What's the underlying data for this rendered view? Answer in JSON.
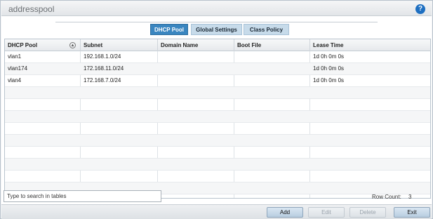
{
  "window": {
    "title": "addresspool"
  },
  "tabs": [
    {
      "label": "DHCP Pool",
      "active": true
    },
    {
      "label": "Global Settings",
      "active": false
    },
    {
      "label": "Class Policy",
      "active": false
    }
  ],
  "table": {
    "columns": [
      "DHCP Pool",
      "Subnet",
      "Domain Name",
      "Boot File",
      "Lease Time"
    ],
    "rows": [
      [
        "vlan1",
        "192.168.1.0/24",
        "",
        "",
        "1d 0h 0m 0s"
      ],
      [
        "vlan174",
        "172.168.11.0/24",
        "",
        "",
        "1d 0h 0m 0s"
      ],
      [
        "vlan4",
        "172.168.7.0/24",
        "",
        "",
        "1d 0h 0m 0s"
      ]
    ]
  },
  "search": {
    "value": "Type to search in tables"
  },
  "row_count": {
    "label": "Row Count:",
    "value": "3"
  },
  "buttons": {
    "add": "Add",
    "edit": "Edit",
    "delete": "Delete",
    "exit": "Exit"
  },
  "colors": {
    "active_tab": "#3a86c0",
    "inactive_tab": "#c7dbea",
    "help_icon": "#1e6fc1"
  },
  "icons": {
    "help": "help-icon",
    "sort": "sort-icon"
  }
}
